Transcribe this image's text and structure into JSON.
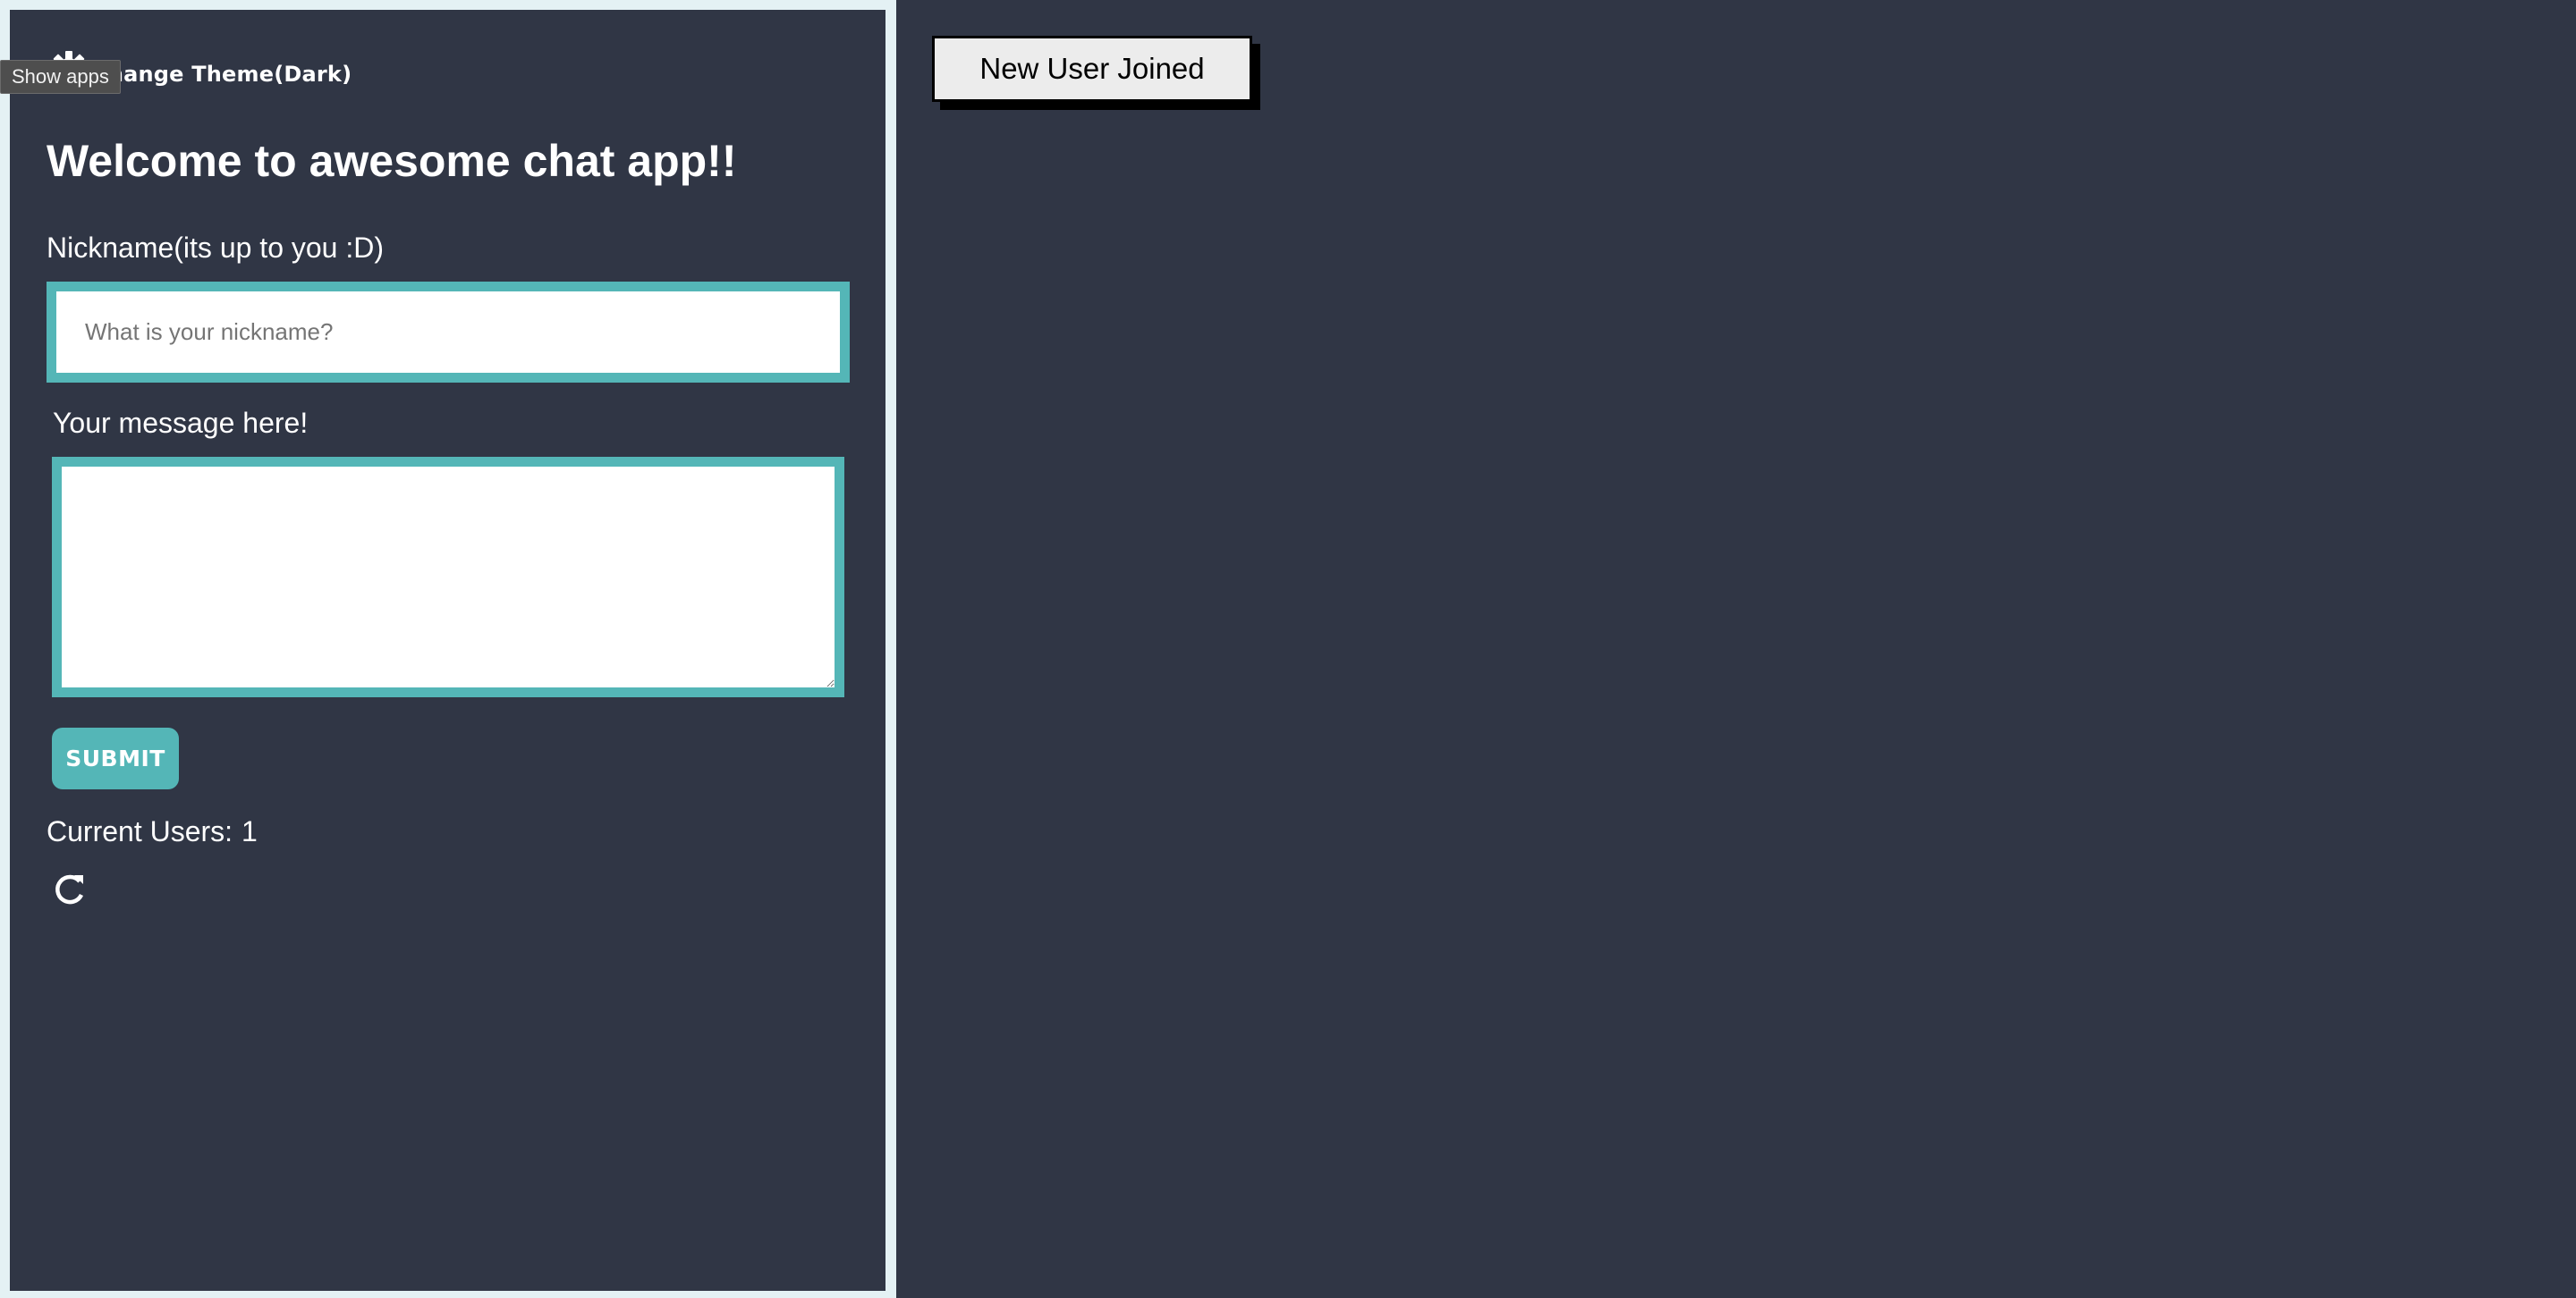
{
  "tooltip": {
    "text": "Show apps"
  },
  "theme": {
    "label": "Change Theme(Dark)",
    "icon": "gear-icon"
  },
  "main": {
    "title": "Welcome to awesome chat app!!",
    "nickname_label": "Nickname(its up to you :D)",
    "nickname_placeholder": "What is your nickname?",
    "nickname_value": "",
    "message_label": "Your message here!",
    "message_value": "",
    "submit_label": "SUBMIT",
    "current_users_label": "Current Users:",
    "current_users_count": "1",
    "refresh_icon": "refresh-icon"
  },
  "notification": {
    "text": "New User Joined"
  },
  "colors": {
    "background": "#303645",
    "accent": "#54b6b7",
    "frame": "#e4f1f4",
    "notification_bg": "#ececec"
  }
}
